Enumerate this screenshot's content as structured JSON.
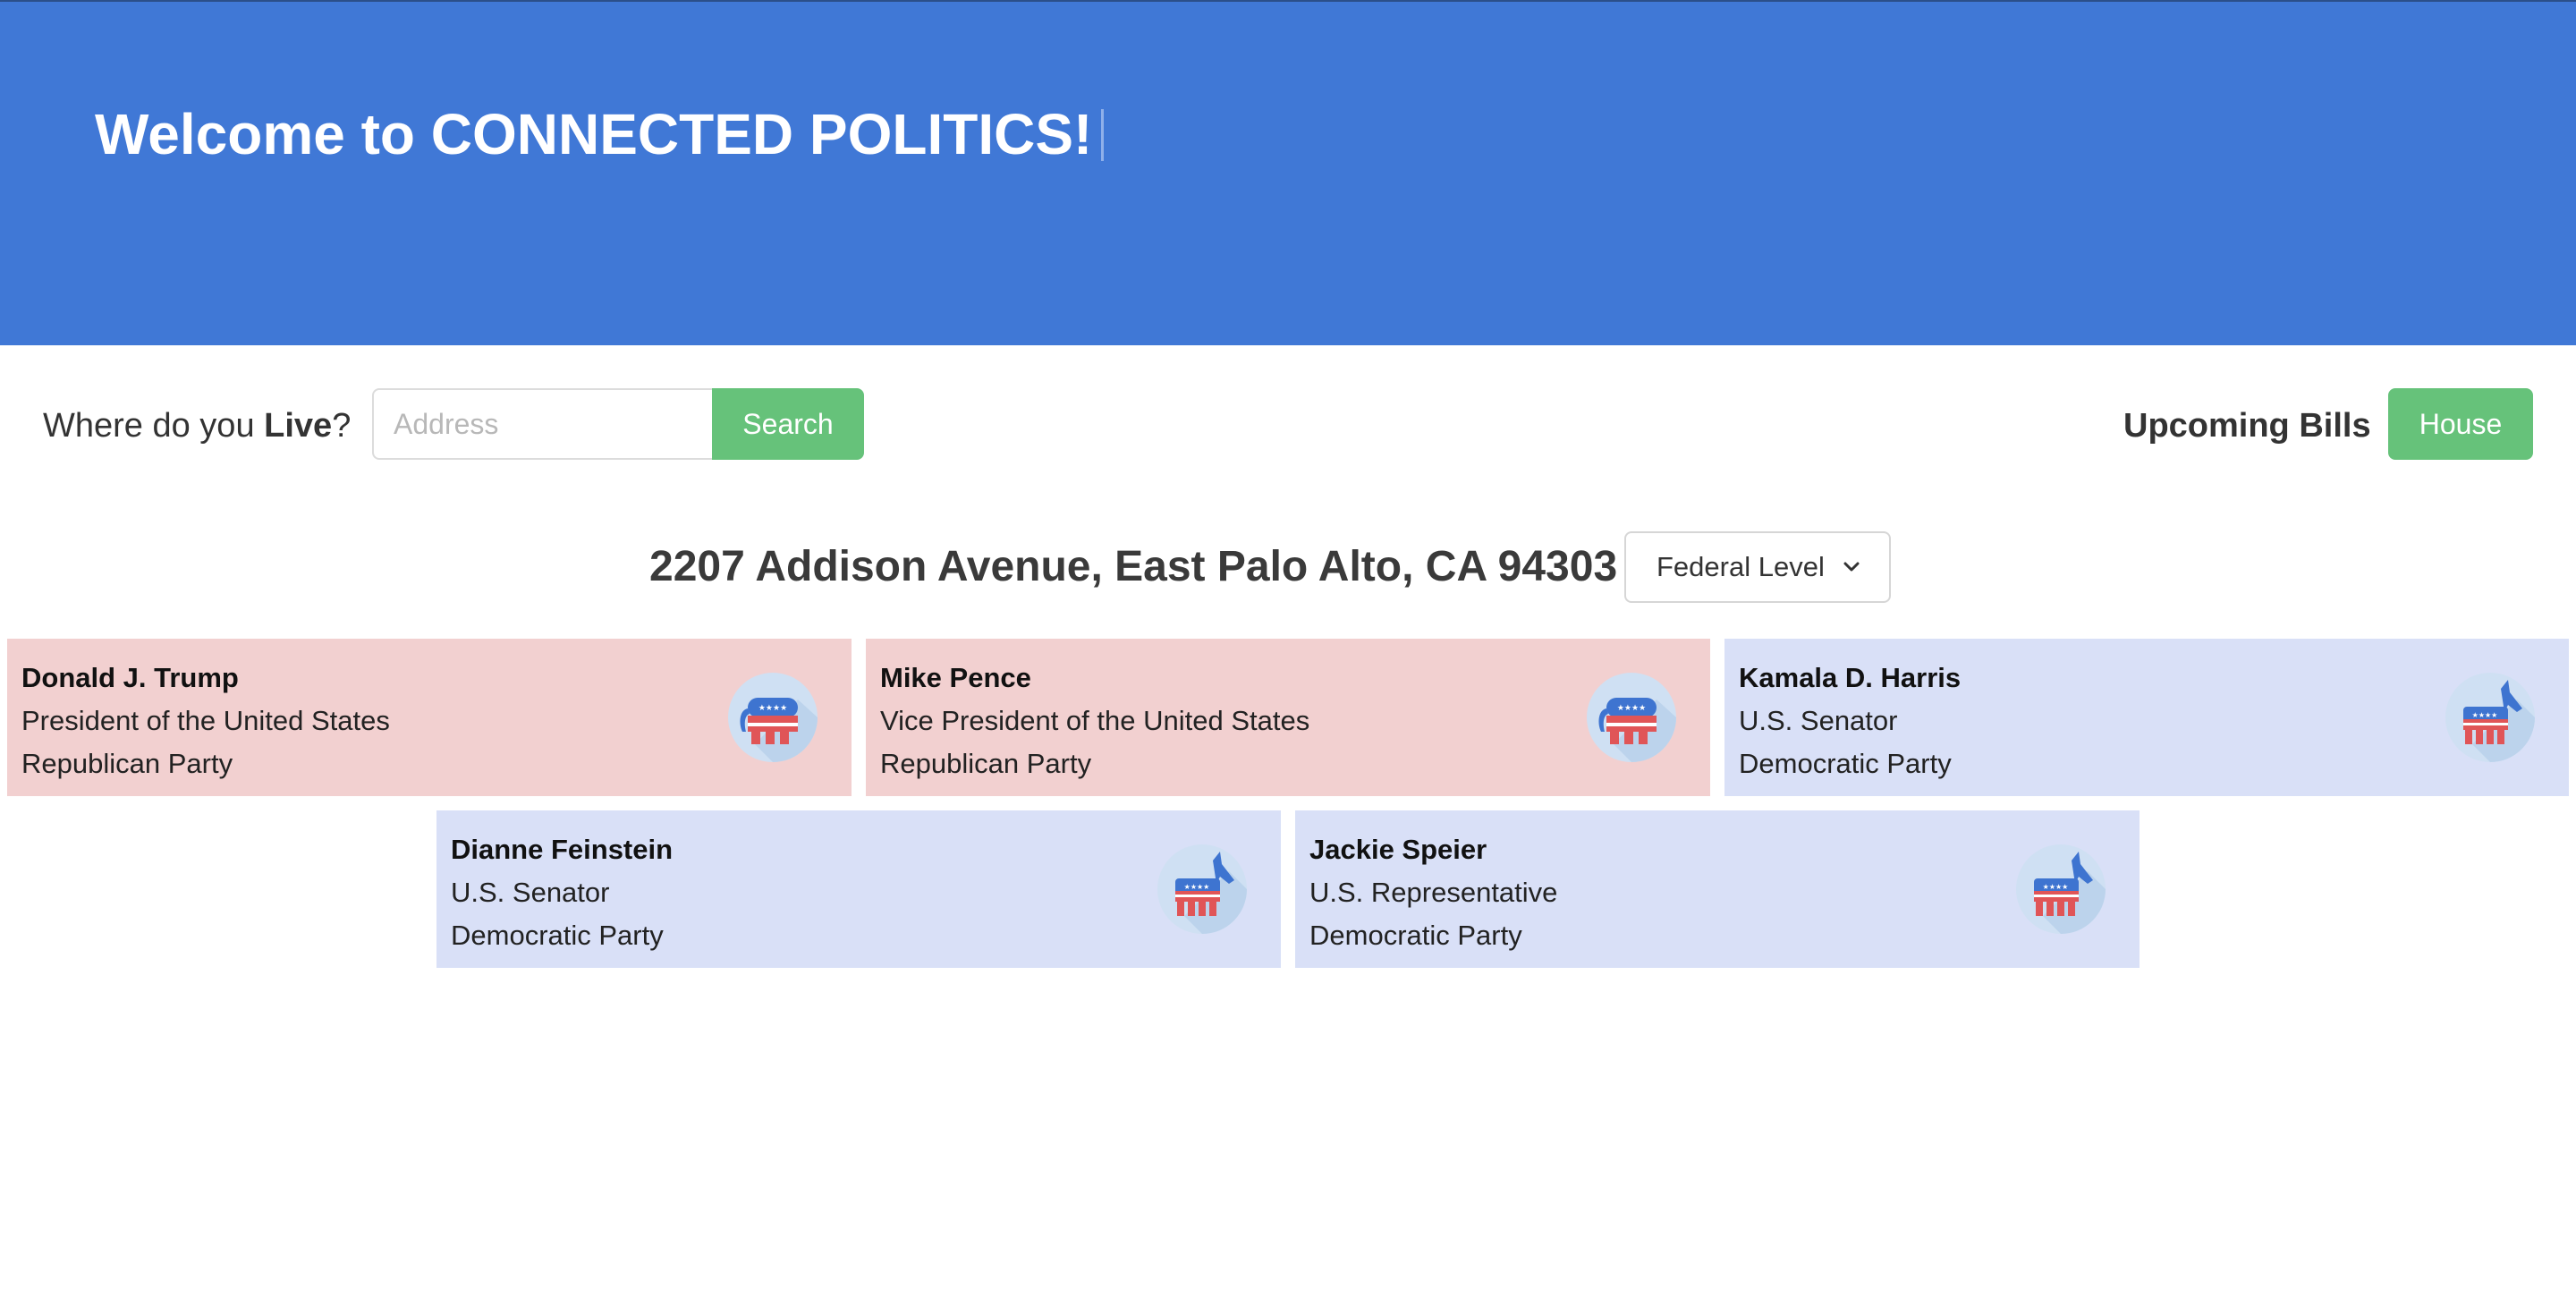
{
  "header": {
    "title": "Welcome to CONNECTED POLITICS!"
  },
  "search": {
    "label_prefix": "Where do you ",
    "label_bold": "Live",
    "label_suffix": "?",
    "placeholder": "Address",
    "button_label": "Search"
  },
  "bills": {
    "label": "Upcoming Bills",
    "button_label": "House"
  },
  "location": {
    "address": "2207 Addison Avenue, East Palo Alto, CA 94303",
    "level_selected": "Federal Level"
  },
  "officials": [
    {
      "name": "Donald J. Trump",
      "office": "President of the United States",
      "party": "Republican Party",
      "icon": "elephant-icon"
    },
    {
      "name": "Mike Pence",
      "office": "Vice President of the United States",
      "party": "Republican Party",
      "icon": "elephant-icon"
    },
    {
      "name": "Kamala D. Harris",
      "office": "U.S. Senator",
      "party": "Democratic Party",
      "icon": "donkey-icon"
    },
    {
      "name": "Dianne Feinstein",
      "office": "U.S. Senator",
      "party": "Democratic Party",
      "icon": "donkey-icon"
    },
    {
      "name": "Jackie Speier",
      "office": "U.S. Representative",
      "party": "Democratic Party",
      "icon": "donkey-icon"
    }
  ],
  "colors": {
    "banner": "#4078d6",
    "accent_green": "#66c27a",
    "republican_card": "#f2d0d0",
    "democratic_card": "#d9e0f7"
  }
}
